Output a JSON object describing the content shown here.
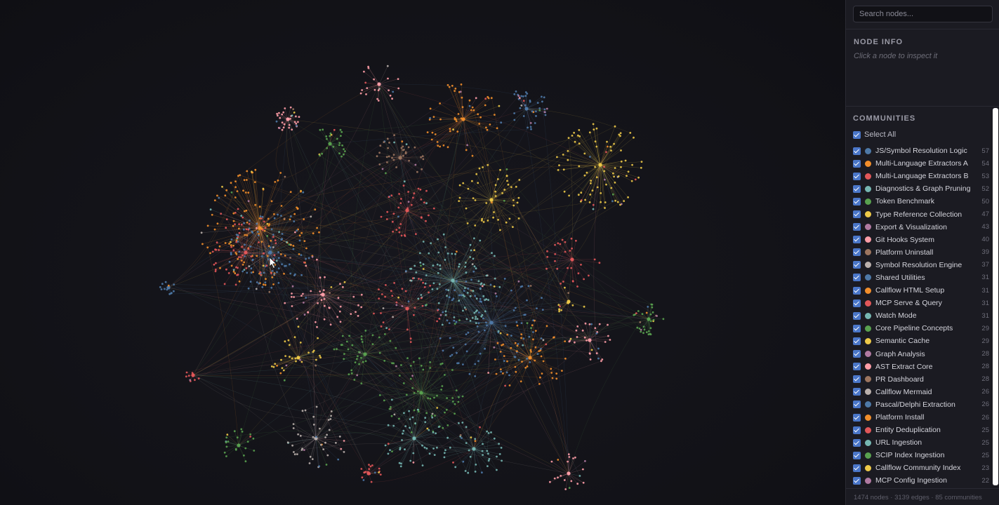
{
  "search": {
    "placeholder": "Search nodes..."
  },
  "node_info": {
    "title": "NODE INFO",
    "hint": "Click a node to inspect it"
  },
  "communities": {
    "title": "COMMUNITIES",
    "select_all_label": "Select All",
    "items": [
      {
        "label": "JS/Symbol Resolution Logic",
        "count": "57",
        "color": "#4e79a7"
      },
      {
        "label": "Multi-Language Extractors A",
        "count": "54",
        "color": "#f28e2b"
      },
      {
        "label": "Multi-Language Extractors B",
        "count": "53",
        "color": "#e15759"
      },
      {
        "label": "Diagnostics & Graph Pruning",
        "count": "52",
        "color": "#76b7b2"
      },
      {
        "label": "Token Benchmark",
        "count": "50",
        "color": "#59a14f"
      },
      {
        "label": "Type Reference Collection",
        "count": "47",
        "color": "#edc948"
      },
      {
        "label": "Export & Visualization",
        "count": "43",
        "color": "#b07aa1"
      },
      {
        "label": "Git Hooks System",
        "count": "40",
        "color": "#ff9da7"
      },
      {
        "label": "Platform Uninstall",
        "count": "39",
        "color": "#9c755f"
      },
      {
        "label": "Symbol Resolution Engine",
        "count": "37",
        "color": "#bab0ac"
      },
      {
        "label": "Shared Utilities",
        "count": "31",
        "color": "#4e79a7"
      },
      {
        "label": "Callflow HTML Setup",
        "count": "31",
        "color": "#f28e2b"
      },
      {
        "label": "MCP Serve & Query",
        "count": "31",
        "color": "#e15759"
      },
      {
        "label": "Watch Mode",
        "count": "31",
        "color": "#76b7b2"
      },
      {
        "label": "Core Pipeline Concepts",
        "count": "29",
        "color": "#59a14f"
      },
      {
        "label": "Semantic Cache",
        "count": "29",
        "color": "#edc948"
      },
      {
        "label": "Graph Analysis",
        "count": "28",
        "color": "#b07aa1"
      },
      {
        "label": "AST Extract Core",
        "count": "28",
        "color": "#ff9da7"
      },
      {
        "label": "PR Dashboard",
        "count": "28",
        "color": "#9c755f"
      },
      {
        "label": "Callflow Mermaid",
        "count": "26",
        "color": "#bab0ac"
      },
      {
        "label": "Pascal/Delphi Extraction",
        "count": "26",
        "color": "#4e79a7"
      },
      {
        "label": "Platform Install",
        "count": "26",
        "color": "#f28e2b"
      },
      {
        "label": "Entity Deduplication",
        "count": "25",
        "color": "#e15759"
      },
      {
        "label": "URL Ingestion",
        "count": "25",
        "color": "#76b7b2"
      },
      {
        "label": "SCIP Index Ingestion",
        "count": "25",
        "color": "#59a14f"
      },
      {
        "label": "Callflow Community Index",
        "count": "23",
        "color": "#edc948"
      },
      {
        "label": "MCP Config Ingestion",
        "count": "22",
        "color": "#b07aa1"
      }
    ]
  },
  "stats": {
    "text": "1474 nodes · 3139 edges · 85 communities"
  }
}
